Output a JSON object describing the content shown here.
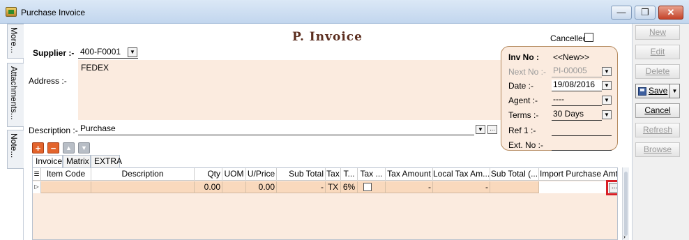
{
  "window": {
    "title": "Purchase Invoice",
    "min_glyph": "—",
    "max_glyph": "❐",
    "close_glyph": "✕"
  },
  "side_tabs": {
    "more": "More...",
    "attachments": "Attachments...",
    "note": "Note..."
  },
  "form": {
    "heading": "P.  Invoice",
    "cancelled_label": "Cancelled",
    "cancelled_checked": false,
    "supplier_label": "Supplier :-",
    "supplier_code": "400-F0001",
    "supplier_name": "FEDEX",
    "address_label": "Address :-",
    "description_label": "Description :-",
    "description_value": "Purchase"
  },
  "invoice_panel": {
    "inv_no_label": "Inv No :",
    "inv_no_value": "<<New>>",
    "next_no_label": "Next No :-",
    "next_no_value": "PI-00005",
    "date_label": "Date :-",
    "date_value": "19/08/2016",
    "agent_label": "Agent :-",
    "agent_value": "----",
    "terms_label": "Terms :-",
    "terms_value": "30 Days",
    "ref1_label": "Ref 1 :-",
    "ref1_value": "",
    "extno_label": "Ext. No :-",
    "extno_value": ""
  },
  "detail_tabs": [
    "Invoice",
    "Matrix",
    "EXTRA"
  ],
  "grid": {
    "columns": [
      "Item Code",
      "Description",
      "Qty",
      "UOM",
      "U/Price",
      "Sub Total",
      "Tax",
      "T...",
      "Tax ...",
      "Tax Amount",
      "Local Tax Am...",
      "Sub Total (...",
      "Import Purchase Amt"
    ],
    "row": {
      "item_code": "",
      "description": "",
      "qty": "0.00",
      "uom": "",
      "uprice": "0.00",
      "subtotal": "-",
      "tax": "TX",
      "tax_rate": "6%",
      "tax_inclusive": false,
      "tax_amount": "-",
      "local_tax_amount": "-",
      "subtotal_tax": "",
      "import_purchase_amt": ""
    },
    "ellipsis": "..."
  },
  "actions": {
    "new": "New",
    "edit": "Edit",
    "delete": "Delete",
    "save": "Save",
    "cancel": "Cancel",
    "refresh": "Refresh",
    "browse": "Browse"
  },
  "colors": {
    "form_bg": "#fbebdf",
    "row_bg": "#f9d9bd",
    "highlight": "#d81f26",
    "heading": "#5b2d1e"
  }
}
